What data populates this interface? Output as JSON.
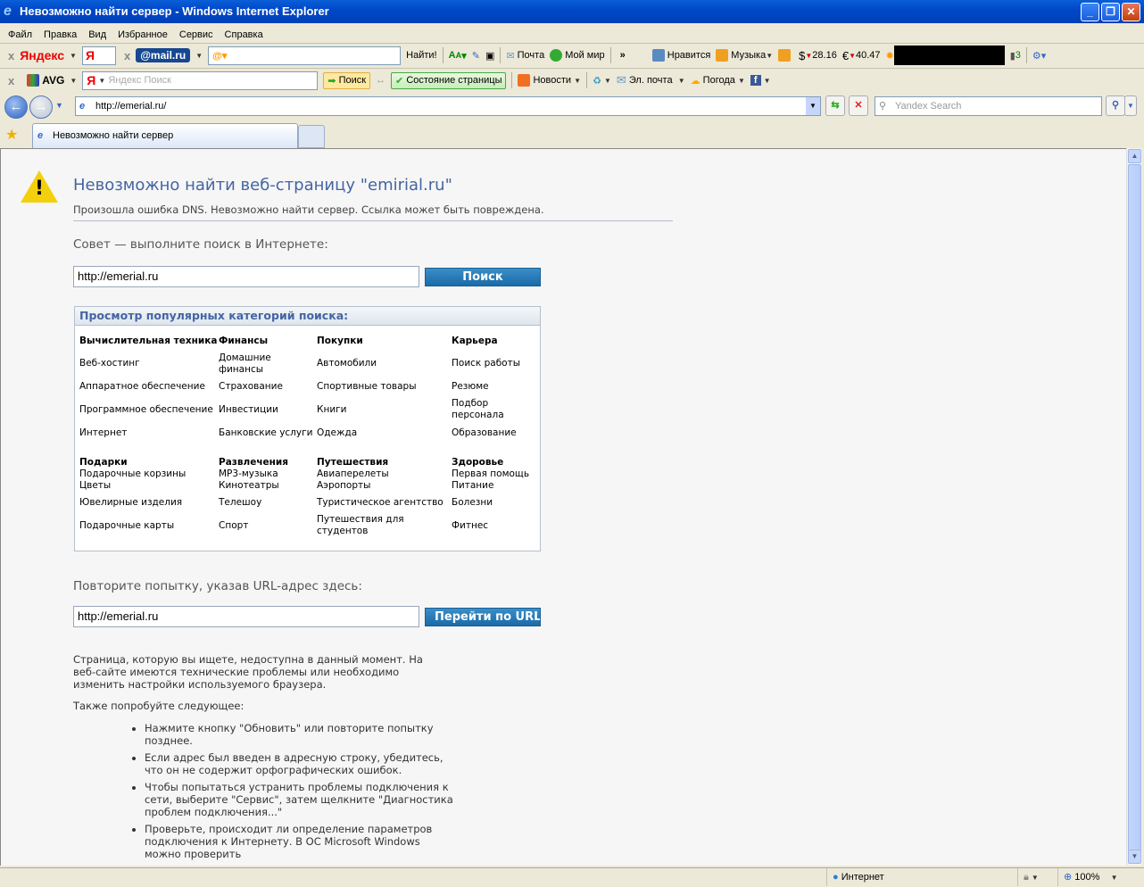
{
  "window": {
    "title": "Невозможно найти сервер - Windows Internet Explorer"
  },
  "menu": [
    "Файл",
    "Правка",
    "Вид",
    "Избранное",
    "Сервис",
    "Справка"
  ],
  "toolbar1": {
    "yandex": "Яндекс",
    "yandex_short": "Я",
    "mailru": "@mail.ru",
    "find": "Найти!",
    "mail": "Почта",
    "moimir": "Мой мир",
    "more": "»",
    "like": "Нравится",
    "music": "Музыка",
    "usd": "28.16",
    "usd_sym": "$",
    "eur": "40.47",
    "eur_sym": "€",
    "traffic": "3"
  },
  "toolbar2": {
    "avg": "AVG",
    "ya": "Я",
    "search_placeholder": "Яндекс Поиск",
    "search_btn": "Поиск",
    "page_status": "Состояние страницы",
    "news": "Новости",
    "email": "Эл. почта",
    "weather": "Погода",
    "fb": "f"
  },
  "address": {
    "url": "http://emerial.ru/",
    "search_placeholder": "Yandex Search"
  },
  "tabs": [
    {
      "label": "Невозможно найти сервер"
    }
  ],
  "page": {
    "title": "Невозможно найти веб-страницу \"emirial.ru\"",
    "subtitle": "Произошла ошибка DNS. Невозможно найти сервер. Ссылка может быть повреждена.",
    "tip": "Совет — выполните поиск в Интернете:",
    "search_value": "http://emerial.ru",
    "search_btn": "Поиск",
    "categories_title": "Просмотр популярных категорий поиска:",
    "categories": [
      {
        "title": "Вычислительная техника",
        "items": [
          "Веб-хостинг",
          "Аппаратное обеспечение",
          "Программное обеспечение",
          "Интернет"
        ]
      },
      {
        "title": "Финансы",
        "items": [
          "Домашние финансы",
          "Страхование",
          "Инвестиции",
          "Банковские услуги"
        ]
      },
      {
        "title": "Покупки",
        "items": [
          "Автомобили",
          "Спортивные товары",
          "Книги",
          "Одежда"
        ]
      },
      {
        "title": "Карьера",
        "items": [
          "Поиск работы",
          "Резюме",
          "Подбор персонала",
          "Образование"
        ]
      },
      {
        "title": "Подарки",
        "items": [
          "Подарочные корзины",
          "Цветы",
          "Ювелирные изделия",
          "Подарочные карты"
        ]
      },
      {
        "title": "Развлечения",
        "items": [
          "MP3-музыка",
          "Кинотеатры",
          "Телешоу",
          "Спорт"
        ]
      },
      {
        "title": "Путешествия",
        "items": [
          "Авиаперелеты",
          "Аэропорты",
          "Туристическое агентство",
          "Путешествия для студентов"
        ]
      },
      {
        "title": "Здоровье",
        "items": [
          "Первая помощь",
          "Питание",
          "Болезни",
          "Фитнес"
        ]
      }
    ],
    "retry": "Повторите попытку, указав URL-адрес здесь:",
    "url_value": "http://emerial.ru",
    "go_btn": "Перейти по URL-адресу",
    "unavailable": "Страница, которую вы ищете, недоступна в данный момент. На веб-сайте имеются технические проблемы или необходимо изменить настройки используемого браузера.",
    "also": "Также попробуйте следующее:",
    "tips": [
      "Нажмите кнопку \"Обновить\" или повторите попытку позднее.",
      "Если адрес был введен в адресную строку, убедитесь, что он не содержит орфографических ошибок.",
      "Чтобы попытаться устранить проблемы подключения к сети, выберите \"Сервис\", затем щелкните \"Диагностика проблем подключения...\"",
      "Проверьте, происходит ли определение параметров подключения к Интернету. В ОС Microsoft Windows можно проверить"
    ]
  },
  "status": {
    "zone": "Интернет",
    "zoom": "100%"
  }
}
